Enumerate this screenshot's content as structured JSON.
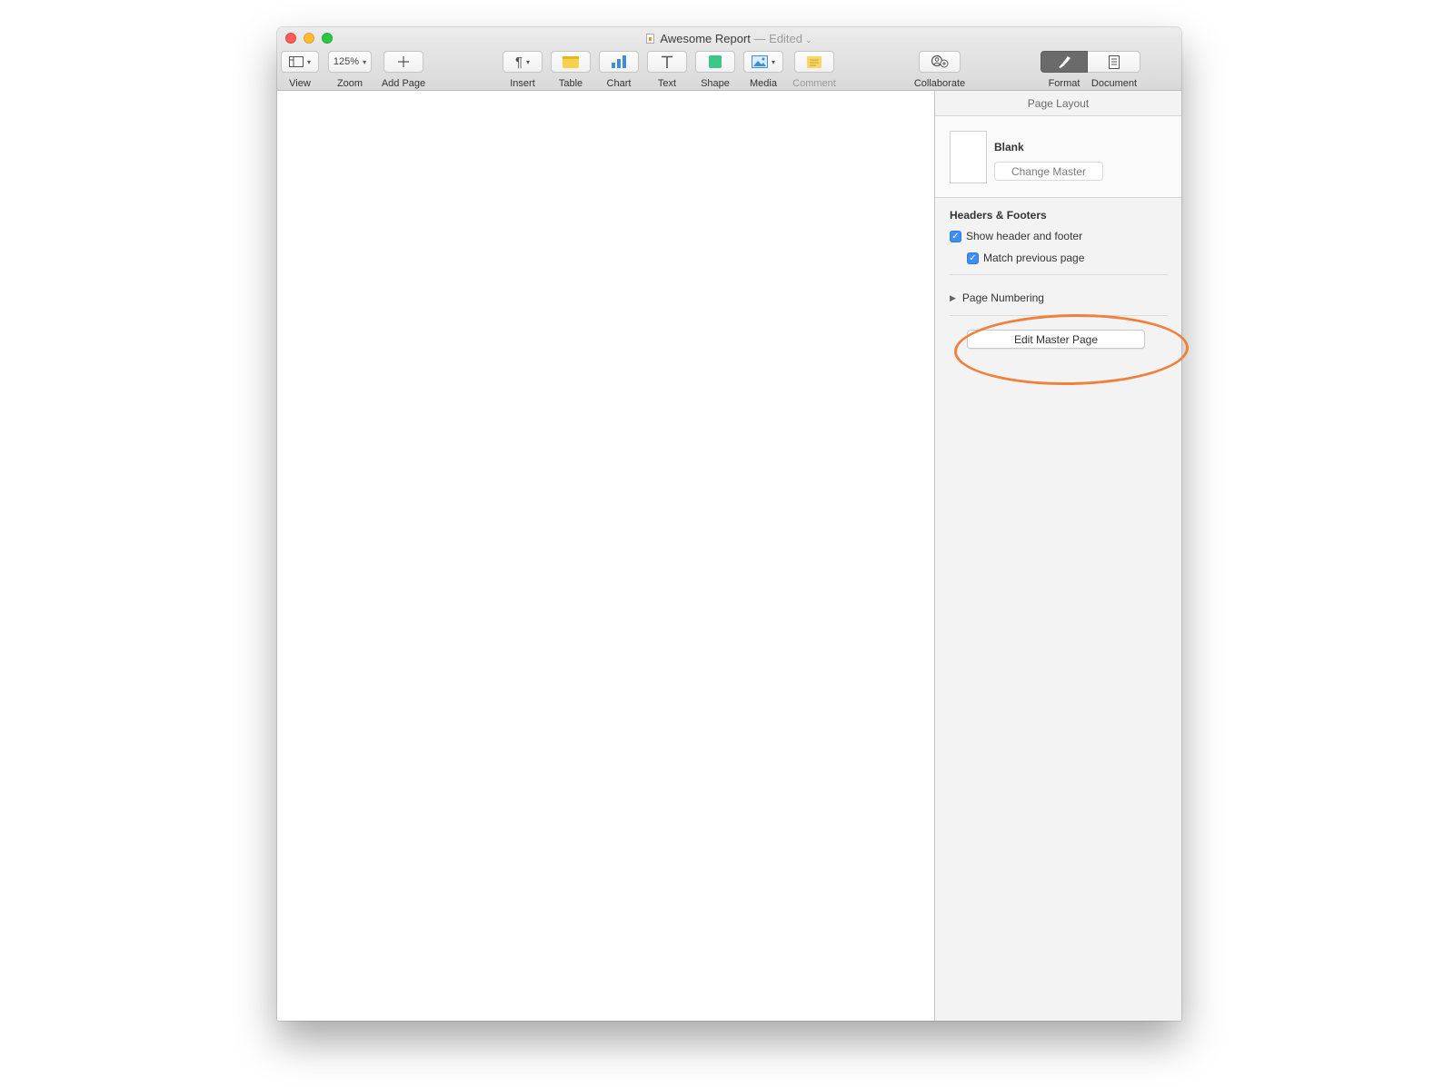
{
  "window": {
    "title": "Awesome Report",
    "status": "— Edited",
    "status_chevron": "⌄"
  },
  "toolbar": {
    "view": {
      "label": "View"
    },
    "zoom": {
      "value": "125%",
      "label": "Zoom"
    },
    "add_page": {
      "label": "Add Page"
    },
    "insert": {
      "label": "Insert"
    },
    "table": {
      "label": "Table"
    },
    "chart": {
      "label": "Chart"
    },
    "text": {
      "label": "Text"
    },
    "shape": {
      "label": "Shape"
    },
    "media": {
      "label": "Media"
    },
    "comment": {
      "label": "Comment"
    },
    "collaborate": {
      "label": "Collaborate"
    },
    "format": {
      "label": "Format"
    },
    "document": {
      "label": "Document"
    }
  },
  "inspector": {
    "header": "Page Layout",
    "master": {
      "name": "Blank",
      "change_button": "Change Master"
    },
    "headers_footers": {
      "title": "Headers & Footers",
      "show_header_footer": {
        "label": "Show header and footer",
        "checked": true
      },
      "match_previous": {
        "label": "Match previous page",
        "checked": true
      }
    },
    "page_numbering": {
      "label": "Page Numbering"
    },
    "edit_master_button": "Edit Master Page"
  },
  "colors": {
    "highlight": "#f0803c",
    "checkbox": "#3e8ef7",
    "table_icon": "#f5d24a",
    "chart_icon": "#3d8ed8",
    "shape_icon": "#3cc68a",
    "comment_icon": "#f8d66a"
  }
}
